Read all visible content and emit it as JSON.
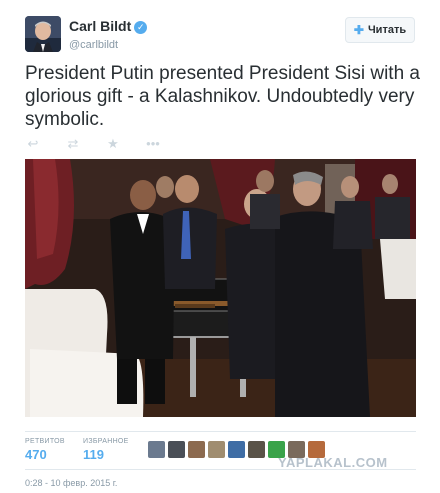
{
  "author": {
    "name": "Carl Bildt",
    "handle": "@carlbildt",
    "verified_icon": "✓"
  },
  "follow_button": {
    "label": "Читать",
    "icon": "+👤"
  },
  "tweet": {
    "text": "President Putin presented President Sisi with a glorious gift - a Kalashnikov. Undoubtedly very symbolic."
  },
  "actions": [
    {
      "name": "reply-icon",
      "glyph": "↩"
    },
    {
      "name": "retweet-icon",
      "glyph": "⇄"
    },
    {
      "name": "favorite-icon",
      "glyph": "★"
    },
    {
      "name": "more-icon",
      "glyph": "•••"
    }
  ],
  "stats": {
    "retweets_label": "РЕТВИТОВ",
    "retweets_value": "470",
    "favorites_label": "ИЗБРАННОЕ",
    "favorites_value": "119"
  },
  "timestamp": "0:28 - 10 февр. 2015 г.",
  "watermark": "YAPLAKAL.COM",
  "colors": {
    "accent": "#55acee",
    "text": "#292f33",
    "muted": "#8899a6"
  },
  "favoriter_avatars": [
    {
      "color": "#6b7a8f"
    },
    {
      "color": "#4a4f57"
    },
    {
      "color": "#8c6a4f"
    },
    {
      "color": "#a08d70"
    },
    {
      "color": "#3f6da5"
    },
    {
      "color": "#5a5348"
    },
    {
      "color": "#3aa34a"
    },
    {
      "color": "#7a6a5c"
    },
    {
      "color": "#b56a3c"
    }
  ]
}
